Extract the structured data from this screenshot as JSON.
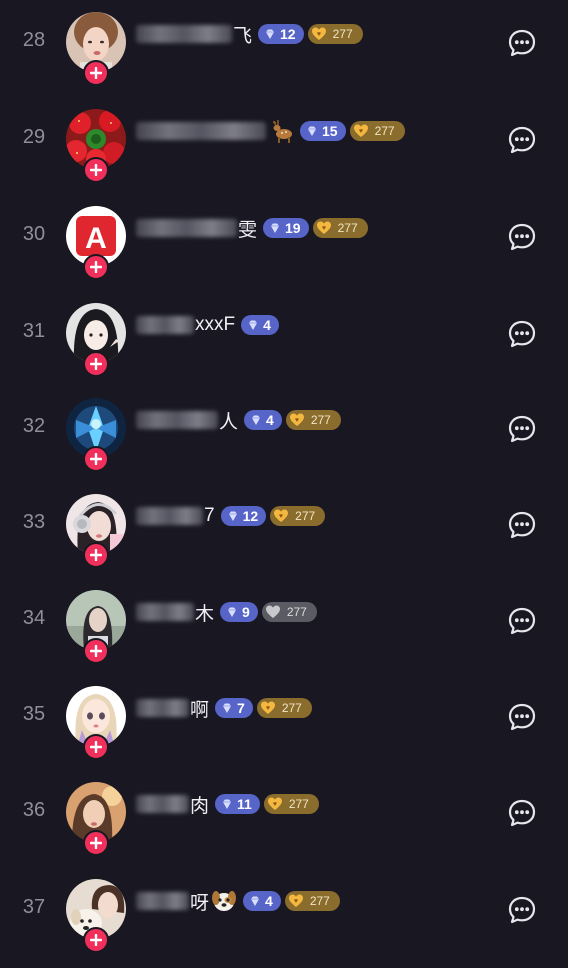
{
  "colors": {
    "background": "#181722",
    "follow": "#f0305a",
    "level_badge": "#5765c8",
    "fan_badge": "#8a6c2c",
    "fan_badge_grey": "#5b5b63"
  },
  "rows": [
    {
      "rank": "28",
      "name_suffix": "飞",
      "emoji": "",
      "level": "12",
      "fan_count": "277",
      "fan_style": "gold",
      "avatar": "woman-portrait",
      "blur_len": 1.0
    },
    {
      "rank": "29",
      "name_suffix": "",
      "emoji": "deer",
      "level": "15",
      "fan_count": "277",
      "fan_style": "gold",
      "avatar": "strawberries",
      "blur_len": 1.35
    },
    {
      "rank": "30",
      "name_suffix": "雯",
      "emoji": "",
      "level": "19",
      "fan_count": "277",
      "fan_style": "gold",
      "avatar": "letter-a",
      "blur_len": 1.05
    },
    {
      "rank": "31",
      "name_suffix": "xxxF",
      "emoji": "",
      "level": "4",
      "fan_count": "",
      "fan_style": "none",
      "avatar": "anime-girl",
      "blur_len": 0.6
    },
    {
      "rank": "32",
      "name_suffix": "人",
      "emoji": "",
      "level": "4",
      "fan_count": "277",
      "fan_style": "gold",
      "avatar": "game-character",
      "blur_len": 0.85
    },
    {
      "rank": "33",
      "name_suffix": "7",
      "emoji": "",
      "level": "12",
      "fan_count": "277",
      "fan_style": "gold",
      "avatar": "girl-headphones",
      "blur_len": 0.7
    },
    {
      "rank": "34",
      "name_suffix": "木",
      "emoji": "",
      "level": "9",
      "fan_count": "277",
      "fan_style": "grey",
      "avatar": "girl-outdoor",
      "blur_len": 0.6
    },
    {
      "rank": "35",
      "name_suffix": "啊",
      "emoji": "",
      "level": "7",
      "fan_count": "277",
      "fan_style": "gold",
      "avatar": "cartoon-girl",
      "blur_len": 0.55
    },
    {
      "rank": "36",
      "name_suffix": "肉",
      "emoji": "",
      "level": "11",
      "fan_count": "277",
      "fan_style": "gold",
      "avatar": "girl-sunset",
      "blur_len": 0.55
    },
    {
      "rank": "37",
      "name_suffix": "呀",
      "emoji": "dog",
      "level": "4",
      "fan_count": "277",
      "fan_style": "gold",
      "avatar": "girl-dog",
      "blur_len": 0.55
    }
  ]
}
